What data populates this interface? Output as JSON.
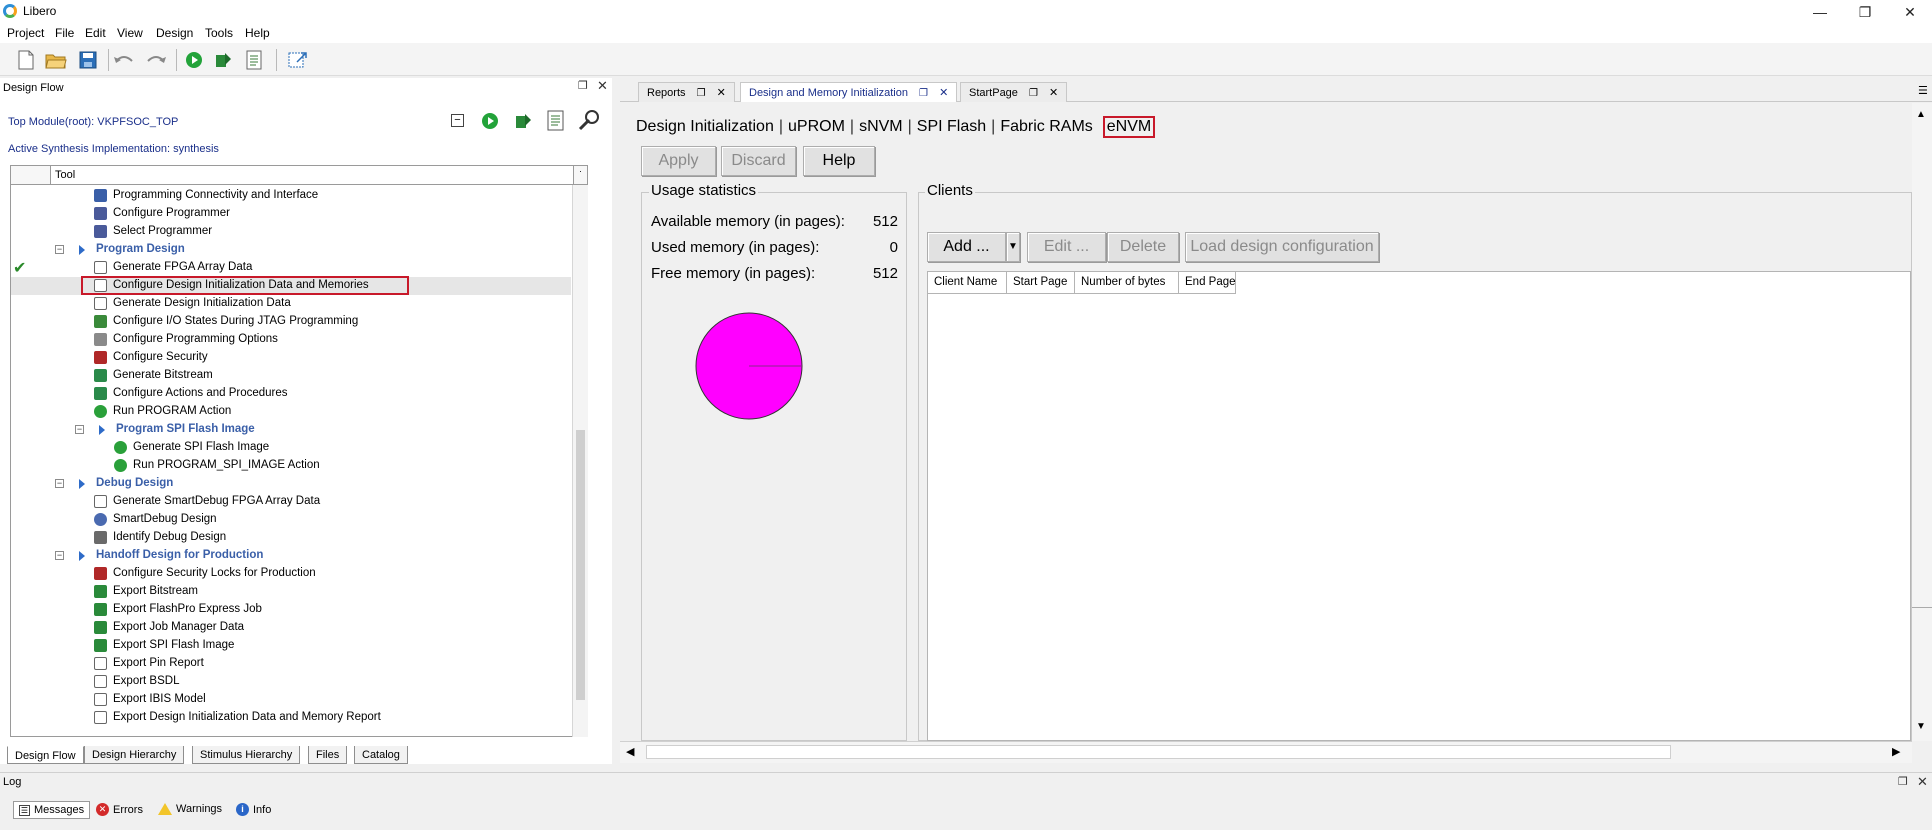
{
  "window": {
    "title": "Libero"
  },
  "menu": [
    "Project",
    "File",
    "Edit",
    "View",
    "Design",
    "Tools",
    "Help"
  ],
  "design_flow": {
    "title": "Design Flow",
    "top_module": "Top Module(root): VKPFSOC_TOP",
    "active_synthesis": "Active Synthesis Implementation: synthesis",
    "column_header": "Tool",
    "tree": [
      {
        "label": "Programming Connectivity and Interface",
        "icon": "connectivity-icon"
      },
      {
        "label": "Configure Programmer",
        "icon": "programmer-icon"
      },
      {
        "label": "Select Programmer",
        "icon": "programmer-icon"
      },
      {
        "label": "Program Design",
        "icon": "group-arrow-icon",
        "group": true
      },
      {
        "label": "Generate FPGA Array Data",
        "icon": "document-icon",
        "check": true
      },
      {
        "label": "Configure Design Initialization Data and Memories",
        "icon": "document-icon",
        "selected": true
      },
      {
        "label": "Generate Design Initialization Data",
        "icon": "document-icon"
      },
      {
        "label": "Configure I/O States During JTAG Programming",
        "icon": "io-states-icon"
      },
      {
        "label": "Configure Programming Options",
        "icon": "options-icon"
      },
      {
        "label": "Configure Security",
        "icon": "security-icon"
      },
      {
        "label": "Generate Bitstream",
        "icon": "bitstream-icon"
      },
      {
        "label": "Configure Actions and Procedures",
        "icon": "actions-icon"
      },
      {
        "label": "Run PROGRAM Action",
        "icon": "run-icon"
      },
      {
        "label": "Program SPI Flash Image",
        "icon": "group-arrow-icon",
        "group": true,
        "sub": true
      },
      {
        "label": "Generate SPI Flash Image",
        "icon": "run-icon",
        "sub": true
      },
      {
        "label": "Run PROGRAM_SPI_IMAGE Action",
        "icon": "run-icon",
        "sub": true
      },
      {
        "label": "Debug Design",
        "icon": "group-arrow-icon",
        "group": true
      },
      {
        "label": "Generate SmartDebug FPGA Array Data",
        "icon": "document-icon"
      },
      {
        "label": "SmartDebug Design",
        "icon": "smartdebug-icon"
      },
      {
        "label": "Identify Debug Design",
        "icon": "identify-icon"
      },
      {
        "label": "Handoff Design for Production",
        "icon": "group-arrow-icon",
        "group": true
      },
      {
        "label": "Configure Security Locks for Production",
        "icon": "security-icon"
      },
      {
        "label": "Export Bitstream",
        "icon": "export-icon"
      },
      {
        "label": "Export FlashPro Express Job",
        "icon": "export-icon"
      },
      {
        "label": "Export Job Manager Data",
        "icon": "export-icon"
      },
      {
        "label": "Export SPI Flash Image",
        "icon": "export-icon"
      },
      {
        "label": "Export Pin Report",
        "icon": "document-icon"
      },
      {
        "label": "Export BSDL",
        "icon": "document-icon"
      },
      {
        "label": "Export IBIS Model",
        "icon": "document-icon"
      },
      {
        "label": "Export Design Initialization Data and Memory Report",
        "icon": "document-icon"
      }
    ],
    "bottom_tabs": [
      "Design Flow",
      "Design Hierarchy",
      "Stimulus Hierarchy",
      "Files",
      "Catalog"
    ]
  },
  "tabs": [
    {
      "label": "Reports"
    },
    {
      "label": "Design and Memory Initialization",
      "active": true
    },
    {
      "label": "StartPage"
    }
  ],
  "subnav": [
    "Design Initialization",
    "uPROM",
    "sNVM",
    "SPI Flash",
    "Fabric RAMs",
    "eNVM"
  ],
  "actions": {
    "apply": "Apply",
    "discard": "Discard",
    "help": "Help"
  },
  "usage": {
    "title": "Usage statistics",
    "available_label": "Available memory (in pages):",
    "available_value": "512",
    "used_label": "Used memory (in pages):",
    "used_value": "0",
    "free_label": "Free memory (in pages):",
    "free_value": "512",
    "pie_color": "#ff00ff",
    "used_fraction": 0,
    "free_fraction": 1
  },
  "clients": {
    "title": "Clients",
    "add": "Add ...",
    "edit": "Edit ...",
    "delete": "Delete",
    "load": "Load design configuration",
    "columns": [
      "Client Name",
      "Start Page",
      "Number of bytes",
      "End Page"
    ]
  },
  "log": {
    "title": "Log",
    "tabs": [
      "Messages",
      "Errors",
      "Warnings",
      "Info"
    ]
  },
  "colors": {
    "highlight": "#c8192a",
    "link": "#1a2f8a",
    "group": "#3a5fa8"
  }
}
